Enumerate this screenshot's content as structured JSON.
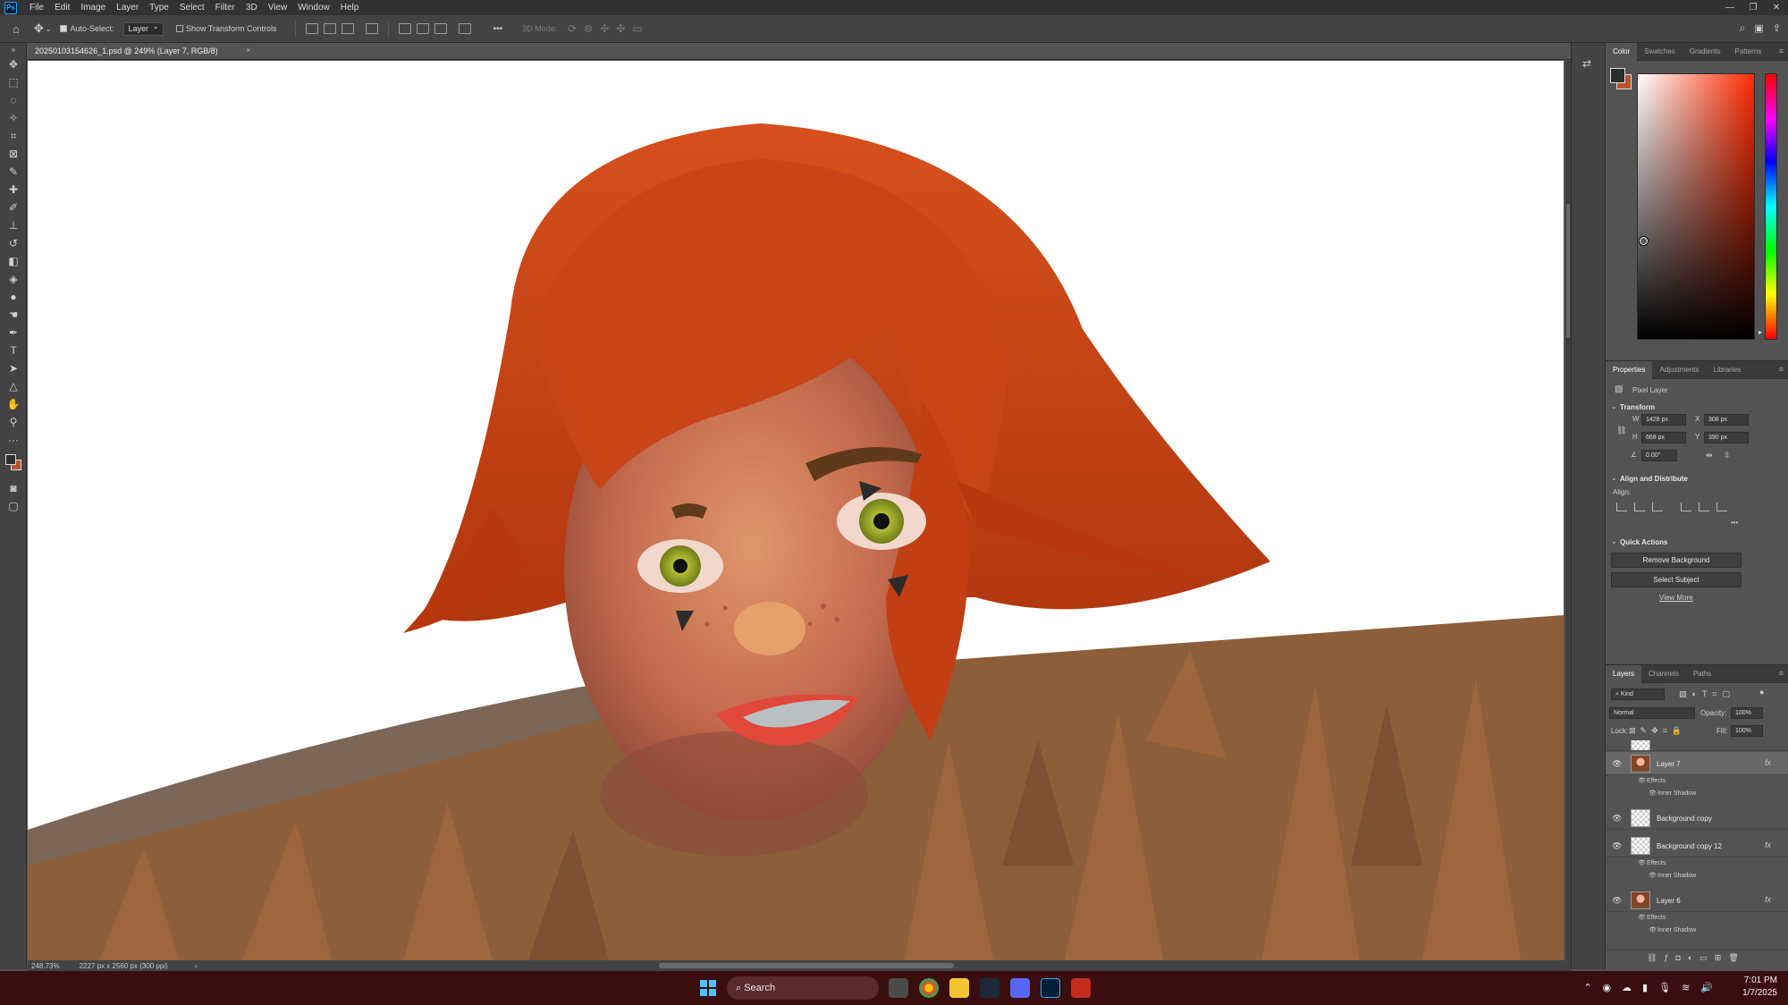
{
  "app": {
    "logo": "Ps",
    "menu": [
      "File",
      "Edit",
      "Image",
      "Layer",
      "Type",
      "Select",
      "Filter",
      "3D",
      "View",
      "Window",
      "Help"
    ],
    "window_controls": [
      "—",
      "❐",
      "✕"
    ]
  },
  "options_bar": {
    "auto_select_label": "Auto-Select:",
    "auto_select_target": "Layer",
    "show_transform_label": "Show Transform Controls",
    "mode_3d": "3D Mode:",
    "more": "•••"
  },
  "document": {
    "tab_title": "20250103154626_1.psd @ 249% (Layer 7, RGB/8)",
    "close": "×"
  },
  "status": {
    "zoom": "248.73%",
    "dimensions": "2227 px x 2560 px (300 ppi)"
  },
  "color_panel": {
    "tabs": [
      "Color",
      "Swatches",
      "Gradients",
      "Patterns"
    ],
    "foreground": "#2c2c2c",
    "background": "#b7542c"
  },
  "properties_panel": {
    "tabs": [
      "Properties",
      "Adjustments",
      "Libraries"
    ],
    "layer_type": "Pixel Layer",
    "transform_title": "Transform",
    "w_label": "W",
    "w_value": "1428 px",
    "h_label": "H",
    "h_value": "668 px",
    "x_label": "X",
    "x_value": "308 px",
    "y_label": "Y",
    "y_value": "390 px",
    "angle_value": "0.00°",
    "align_title": "Align and Distribute",
    "align_label": "Align:",
    "quick_actions_title": "Quick Actions",
    "remove_background": "Remove Background",
    "select_subject": "Select Subject",
    "view_more": "View More"
  },
  "layers_panel": {
    "tabs": [
      "Layers",
      "Channels",
      "Paths"
    ],
    "kind_filter": "Kind",
    "blend_mode": "Normal",
    "opacity_label": "Opacity:",
    "opacity_value": "100%",
    "lock_label": "Lock:",
    "fill_label": "Fill:",
    "fill_value": "100%",
    "layers": [
      {
        "name": "Layer 7",
        "selected": true,
        "fx": "fx",
        "effects": "Effects",
        "effect": "Inner Shadow"
      },
      {
        "name": "Background copy",
        "selected": false
      },
      {
        "name": "Background copy 12",
        "selected": false,
        "fx": "fx",
        "effects": "Effects",
        "effect": "Inner Shadow"
      },
      {
        "name": "Layer 6",
        "selected": false,
        "fx": "fx",
        "effects": "Effects",
        "effect": "Inner Shadow"
      }
    ]
  },
  "taskbar": {
    "search_placeholder": "Search",
    "time": "7:01 PM",
    "date": "1/7/2025"
  }
}
